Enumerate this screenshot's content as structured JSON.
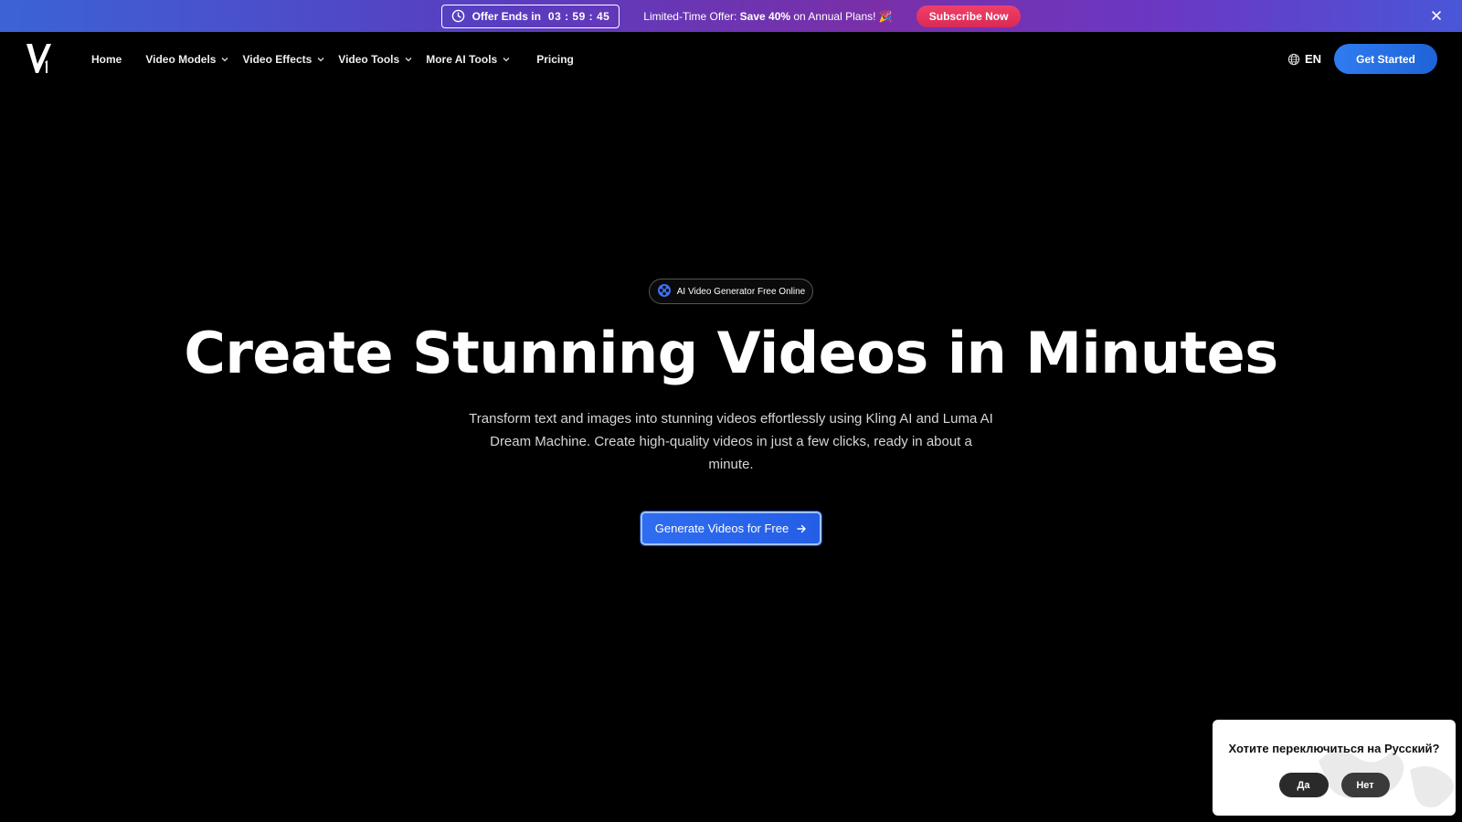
{
  "promo": {
    "offer_label": "Offer Ends in",
    "timer": "03 : 59 : 45",
    "text_prefix": "Limited-Time Offer: ",
    "text_bold": "Save 40%",
    "text_suffix": " on Annual Plans! 🎉",
    "subscribe_label": "Subscribe Now",
    "icons": {
      "clock": "clock-icon",
      "close": "close-icon"
    }
  },
  "nav": {
    "logo_text": "V1",
    "items": [
      {
        "label": "Home",
        "dropdown": false
      },
      {
        "label": "Video Models",
        "dropdown": true
      },
      {
        "label": "Video Effects",
        "dropdown": true
      },
      {
        "label": "Video Tools",
        "dropdown": true
      },
      {
        "label": "More AI Tools",
        "dropdown": true
      },
      {
        "label": "Pricing",
        "dropdown": false
      }
    ],
    "language": "EN",
    "get_started_label": "Get Started"
  },
  "hero": {
    "badge_label": "AI Video Generator Free Online",
    "title": "Create Stunning Videos in Minutes",
    "subtitle": "Transform text and images into stunning videos effortlessly using Kling AI and Luma AI Dream Machine. Create high-quality videos in just a few clicks, ready in about a minute.",
    "cta_label": "Generate Videos for Free"
  },
  "lang_popup": {
    "question": "Хотите переключиться на Русский?",
    "yes_label": "Да",
    "no_label": "Нет"
  },
  "colors": {
    "background": "#000000",
    "accent_blue": "#2f6df0",
    "subscribe_pink": "#e1335e",
    "promo_gradient_start": "#3b63d6",
    "promo_gradient_mid": "#7a2fa8"
  }
}
